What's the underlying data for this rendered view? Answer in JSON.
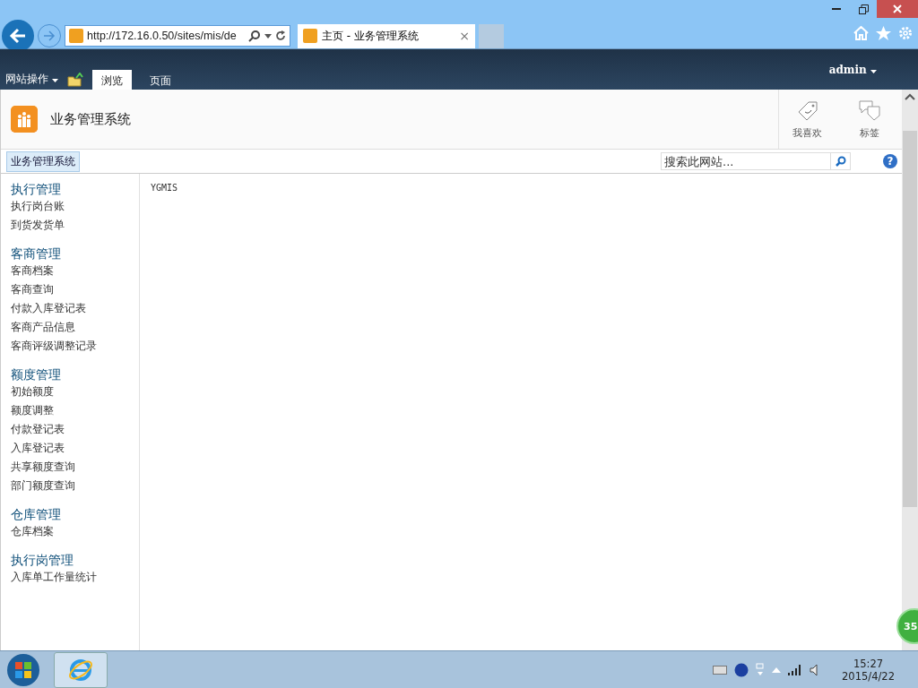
{
  "browser": {
    "address": "http://172.16.0.50/sites/mis/de",
    "tabs": [
      {
        "title": "主页 - 业务管理系统",
        "close": "×",
        "selected": true
      }
    ]
  },
  "ribbon": {
    "site_actions": "网站操作",
    "tabs": [
      {
        "label": "浏览",
        "selected": true
      },
      {
        "label": "页面",
        "selected": false
      }
    ],
    "user": "admin"
  },
  "site": {
    "title": "业务管理系统",
    "actions": [
      {
        "label": "我喜欢",
        "kind": "like"
      },
      {
        "label": "标签",
        "kind": "tags"
      }
    ]
  },
  "breadcrumb": {
    "label": "业务管理系统"
  },
  "search": {
    "placeholder": "搜索此网站...",
    "help": "?"
  },
  "nav": [
    {
      "heading": "执行管理",
      "items": [
        "执行岗台账",
        "到货发货单"
      ]
    },
    {
      "heading": "客商管理",
      "items": [
        "客商档案",
        "客商查询",
        "付款入库登记表",
        "客商产品信息",
        "客商评级调整记录"
      ]
    },
    {
      "heading": "额度管理",
      "items": [
        "初始额度",
        "额度调整",
        "付款登记表",
        "入库登记表",
        "共享额度查询",
        "部门额度查询"
      ]
    },
    {
      "heading": "仓库管理",
      "items": [
        "仓库档案"
      ]
    },
    {
      "heading": "执行岗管理",
      "items": [
        "入库单工作量统计"
      ]
    }
  ],
  "content": {
    "text": "YGMIS"
  },
  "badge": "35",
  "taskbar": {
    "time": "15:27",
    "date": "2015/4/22"
  }
}
